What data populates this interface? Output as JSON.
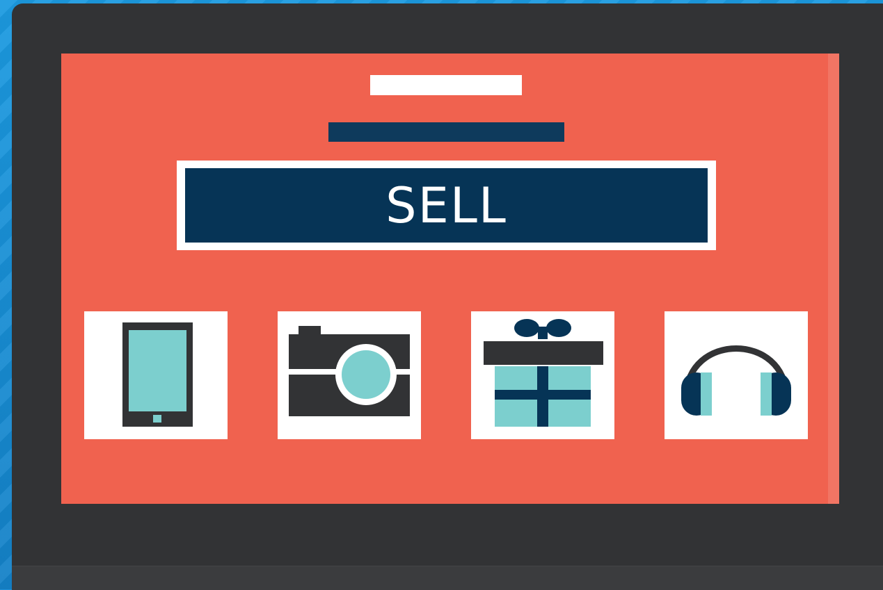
{
  "banner": {
    "label": "SELL"
  },
  "tiles": [
    {
      "icon": "tablet-icon"
    },
    {
      "icon": "camera-icon"
    },
    {
      "icon": "gift-icon"
    },
    {
      "icon": "headphones-icon"
    }
  ],
  "colors": {
    "background": "#1f8fd6",
    "bezel": "#323335",
    "screen": "#f0624f",
    "navy": "#063456",
    "teal": "#7ccfce",
    "white": "#ffffff"
  }
}
